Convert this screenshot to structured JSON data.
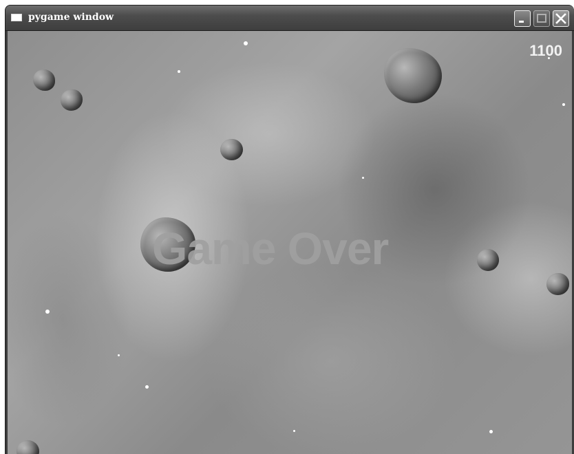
{
  "window": {
    "title": "pygame window",
    "icon": "window-icon",
    "buttons": [
      "minimize-icon",
      "maximize-icon",
      "close-icon"
    ]
  },
  "game": {
    "score": "1100",
    "message": "Game Over",
    "asteroid_count": 8
  }
}
